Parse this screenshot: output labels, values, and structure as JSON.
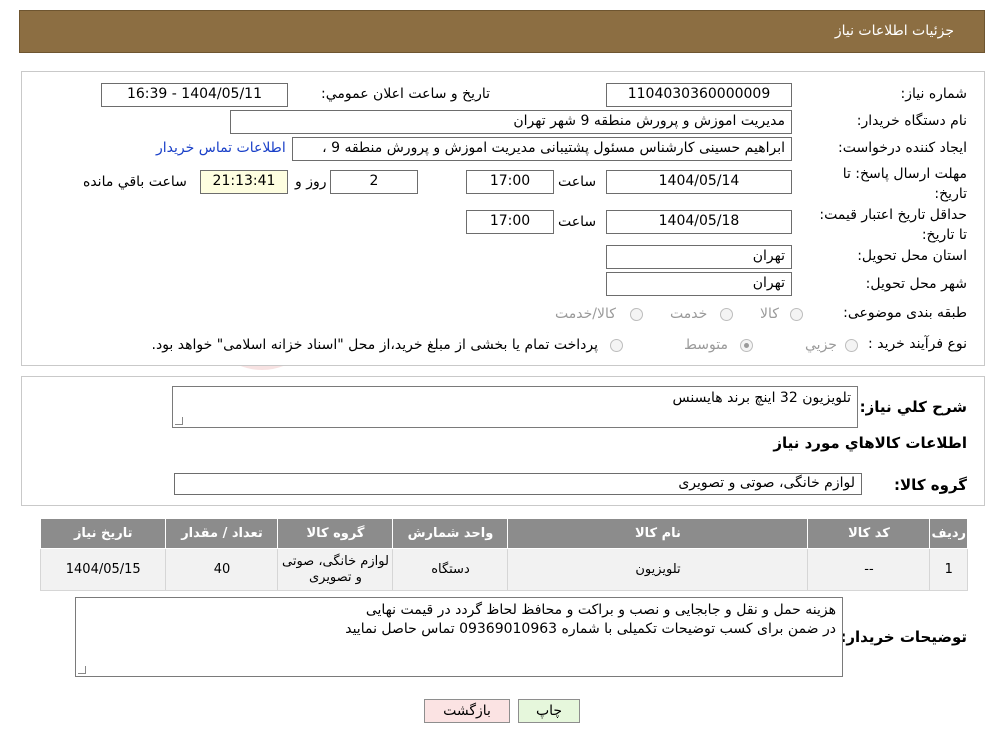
{
  "page": {
    "title": "جزئيات اطلاعات نياز"
  },
  "info": {
    "need_number_label": "شماره نياز:",
    "need_number": "1104030360000009",
    "announce_label": "تاريخ و ساعت اعلان عمومي:",
    "announce_value": "1404/05/11 - 16:39",
    "buyer_org_label": "نام دستگاه خريدار:",
    "buyer_org": "مديريت اموزش و پرورش منطقه 9 شهر تهران",
    "creator_label": "ايجاد کننده درخواست:",
    "creator": "ابراهيم حسينی کارشناس مسئول پشتيبانی مديريت اموزش و پرورش منطقه 9 ،",
    "contact_link": "اطلاعات تماس خريدار",
    "deadline_label": "مهلت ارسال پاسخ: تا تاريخ:",
    "deadline_date": "1404/05/14",
    "time_label": "ساعت",
    "deadline_time": "17:00",
    "days_value": "2",
    "days_label": "روز و",
    "remaining_time": "21:13:41",
    "remaining_label": "ساعت باقي مانده",
    "validity_label": "حداقل تاريخ اعتبار قيمت: تا تاريخ:",
    "validity_date": "1404/05/18",
    "validity_time": "17:00",
    "province_label": "استان محل تحويل:",
    "province": "تهران",
    "city_label": "شهر محل تحويل:",
    "city": "تهران",
    "category_label": "طبقه بندی موضوعی:",
    "category_options": [
      "کالا",
      "خدمت",
      "کالا/خدمت"
    ],
    "process_label": "نوع فرآيند خريد :",
    "process_options": [
      "جزيي",
      "متوسط"
    ],
    "process_note": "پرداخت تمام يا بخشی از مبلغ خريد،از محل \"اسناد خزانه اسلامی\" خواهد بود."
  },
  "summary": {
    "label": "شرح کلي نياز:",
    "value": "تلويزيون 32 اينچ برند هايسنس",
    "goods_title": "اطلاعات کالاهاي مورد نياز",
    "group_label": "گروه کالا:",
    "group_value": "لوازم خانگی، صوتی و تصويری"
  },
  "table": {
    "headers": [
      "رديف",
      "کد کالا",
      "نام کالا",
      "واحد شمارش",
      "گروه کالا",
      "تعداد / مقدار",
      "تاريخ نياز"
    ],
    "rows": [
      [
        "1",
        "--",
        "تلويزيون",
        "دستگاه",
        "لوازم خانگی، صوتی و تصويری",
        "40",
        "1404/05/15"
      ]
    ]
  },
  "notes": {
    "label": "توضيحات خريدار:",
    "line1": "هزينه حمل و نقل و جابجايی و نصب و براکت و محافظ لحاظ گردد در قيمت نهايی",
    "line2": "در ضمن برای کسب توضيحات تکميلی با شماره 09369010963 تماس حاصل نماييد"
  },
  "buttons": {
    "print": "چاپ",
    "back": "بازگشت"
  },
  "colors": {
    "header": "#8c6e42",
    "table_header": "#8c8c8c",
    "back_button": "#fbe3e3",
    "print_button": "#e6f7dc",
    "link": "#1a40c8"
  },
  "watermark": {
    "text": "AriaTender.neT"
  }
}
